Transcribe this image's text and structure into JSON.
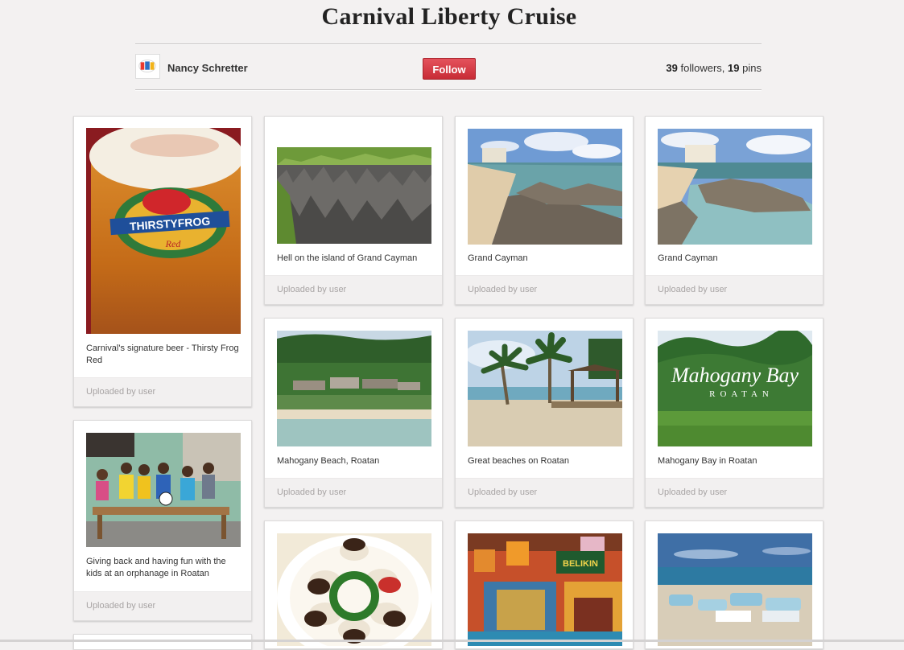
{
  "board": {
    "title": "Carnival Liberty Cruise",
    "owner": "Nancy Schretter",
    "follow_label": "Follow",
    "followers_count": "39",
    "followers_label": "followers,",
    "pins_count": "19",
    "pins_label": "pins"
  },
  "pins": [
    {
      "description": "Carnival's signature beer - Thirsty Frog Red",
      "attribution": "Uploaded by user",
      "image": "thirsty-frog-beer-image",
      "image_text": [
        "THIRSTYFROG",
        "Red"
      ]
    },
    {
      "description": "Hell on the island of Grand Cayman",
      "attribution": "Uploaded by user",
      "image": "hell-rocks-image"
    },
    {
      "description": "Grand Cayman",
      "attribution": "Uploaded by user",
      "image": "grand-cayman-beach-image"
    },
    {
      "description": "Grand Cayman",
      "attribution": "Uploaded by user",
      "image": "grand-cayman-shore-image"
    },
    {
      "description": "Giving back and having fun with the kids at an orphanage in Roatan",
      "attribution": "Uploaded by user",
      "image": "orphanage-kids-image"
    },
    {
      "description": "Mahogany Beach, Roatan",
      "attribution": "Uploaded by user",
      "image": "mahogany-beach-image"
    },
    {
      "description": "Great beaches on Roatan",
      "attribution": "Uploaded by user",
      "image": "roatan-palm-beach-image"
    },
    {
      "description": "Mahogany Bay in Roatan",
      "attribution": "Uploaded by user",
      "image": "mahogany-bay-sign-image",
      "image_text": [
        "Mahogany Bay",
        "ROATAN"
      ]
    },
    {
      "description": "",
      "attribution": "",
      "image": "chocolate-strawberries-image"
    },
    {
      "description": "",
      "attribution": "",
      "image": "belikin-bar-image",
      "image_text": [
        "BELIKIN"
      ]
    },
    {
      "description": "",
      "attribution": "",
      "image": "beach-paddleboats-image"
    }
  ],
  "colors": {
    "follow_button": "#d23a44",
    "background": "#f3f1f1",
    "attribution_bar": "#f2f0f0"
  }
}
